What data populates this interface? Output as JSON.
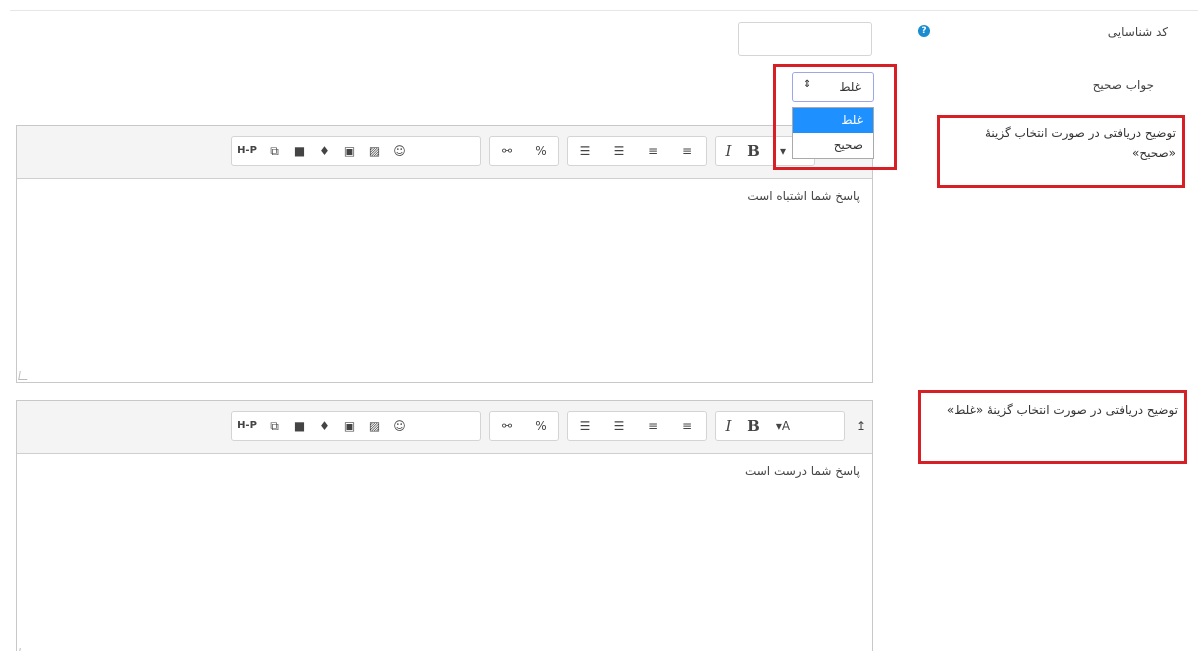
{
  "form": {
    "id_label": "کد شناسایی",
    "id_value": "",
    "help_icon": "question-circle-icon",
    "correct_answer_label": "جواب صحیح",
    "select_value": "غلط",
    "select_options": [
      "غلط",
      "صحیح"
    ],
    "feedback_true_label": "توضیح دریافتی در صورت انتخاب گزینهٔ «صحیح»",
    "feedback_false_label": "توضیح دریافتی در صورت انتخاب گزینهٔ «غلط»"
  },
  "toolbar": {
    "hp_label": "H-P",
    "bold_label": "B",
    "italic_label": "I",
    "font_color_label": "A",
    "expand_label": "↥",
    "icons": [
      "h5p-icon",
      "manage-files-icon",
      "video-record-icon",
      "audio-record-icon",
      "media-icon",
      "image-icon",
      "emoticon-icon",
      "unlink-icon",
      "link-icon",
      "indent-icon",
      "outdent-icon",
      "ordered-list-icon",
      "unordered-list-icon",
      "italic-icon",
      "bold-icon",
      "font-color-icon",
      "toolbar-toggle-icon"
    ]
  },
  "editors": [
    {
      "content": "پاسخ شما اشتباه است"
    },
    {
      "content": "پاسخ شما درست است"
    }
  ],
  "colors": {
    "highlight_red": "#d71f26",
    "select_blue": "#1e90ff",
    "help_blue": "#1a8ccf"
  }
}
